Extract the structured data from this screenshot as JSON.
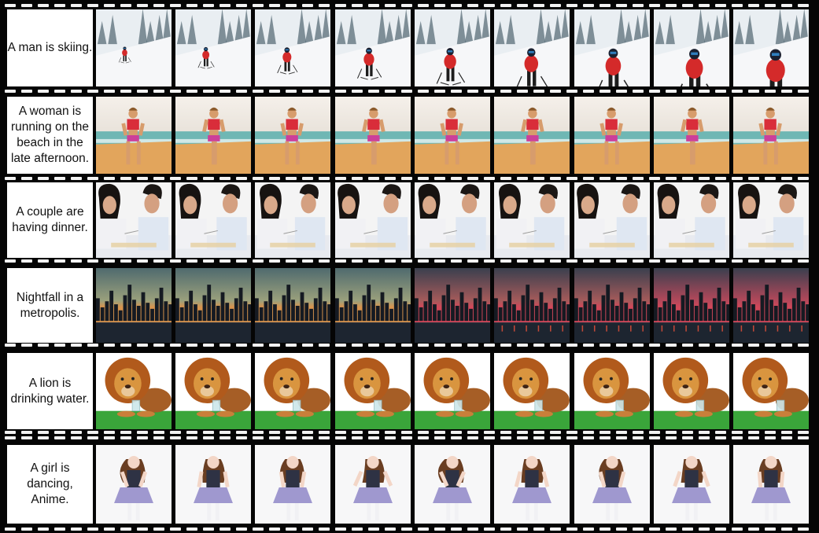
{
  "rows": [
    {
      "caption": "A man is skiing.",
      "scene": "ski"
    },
    {
      "caption": "A woman is running on the beach in the late afternoon.",
      "scene": "beach"
    },
    {
      "caption": "A couple are having dinner.",
      "scene": "dinner"
    },
    {
      "caption": "Nightfall in a metropolis.",
      "scene": "city"
    },
    {
      "caption": "A lion is drinking water.",
      "scene": "lion"
    },
    {
      "caption": "A girl is dancing, Anime.",
      "scene": "anime"
    }
  ],
  "frames_per_row": 9
}
